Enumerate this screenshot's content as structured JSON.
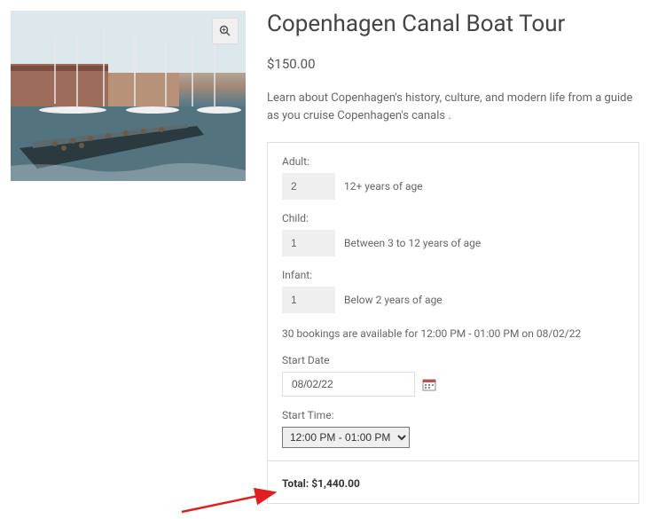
{
  "product": {
    "title": "Copenhagen Canal Boat Tour",
    "price": "$150.00",
    "description": "Learn about Copenhagen's history, culture, and modern life from a guide as you cruise Copenhagen's canals ."
  },
  "form": {
    "adult": {
      "label": "Adult:",
      "value": "2",
      "note": "12+ years of age"
    },
    "child": {
      "label": "Child:",
      "value": "1",
      "note": "Between 3 to 12 years of age"
    },
    "infant": {
      "label": "Infant:",
      "value": "1",
      "note": "Below 2 years of age"
    },
    "availability": "30 bookings are available for 12:00 PM - 01:00 PM on 08/02/22",
    "startDate": {
      "label": "Start Date",
      "value": "08/02/22"
    },
    "startTime": {
      "label": "Start Time:",
      "selected": "12:00 PM - 01:00 PM"
    }
  },
  "total": {
    "label": "Total: ",
    "amount": "$1,440.00"
  }
}
